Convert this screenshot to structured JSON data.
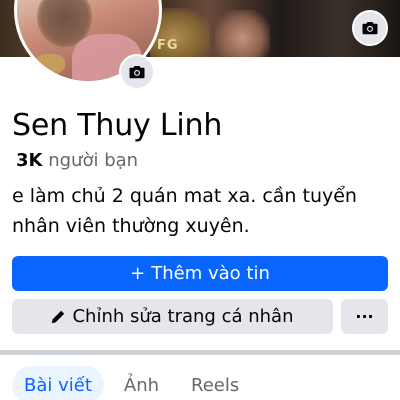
{
  "profile": {
    "name": "Sen Thuy Linh",
    "friends_count": "3K",
    "friends_label": "người bạn",
    "bio": "e làm chủ 2 quán mat xa. cần tuyển nhân viên thường xuyên."
  },
  "cover": {
    "visible_text": "FG"
  },
  "actions": {
    "add_story_icon": "+",
    "add_story_label": "Thêm vào tin",
    "edit_profile_icon": "pencil-icon",
    "edit_profile_label": "Chỉnh sửa trang cá nhân",
    "more_label": "···"
  },
  "tabs": [
    {
      "label": "Bài viết",
      "active": true
    },
    {
      "label": "Ảnh",
      "active": false
    },
    {
      "label": "Reels",
      "active": false
    }
  ],
  "colors": {
    "primary": "#0866ff",
    "secondary_bg": "#e4e6eb",
    "muted_text": "#65676b",
    "active_tab_bg": "#ebf5ff"
  }
}
